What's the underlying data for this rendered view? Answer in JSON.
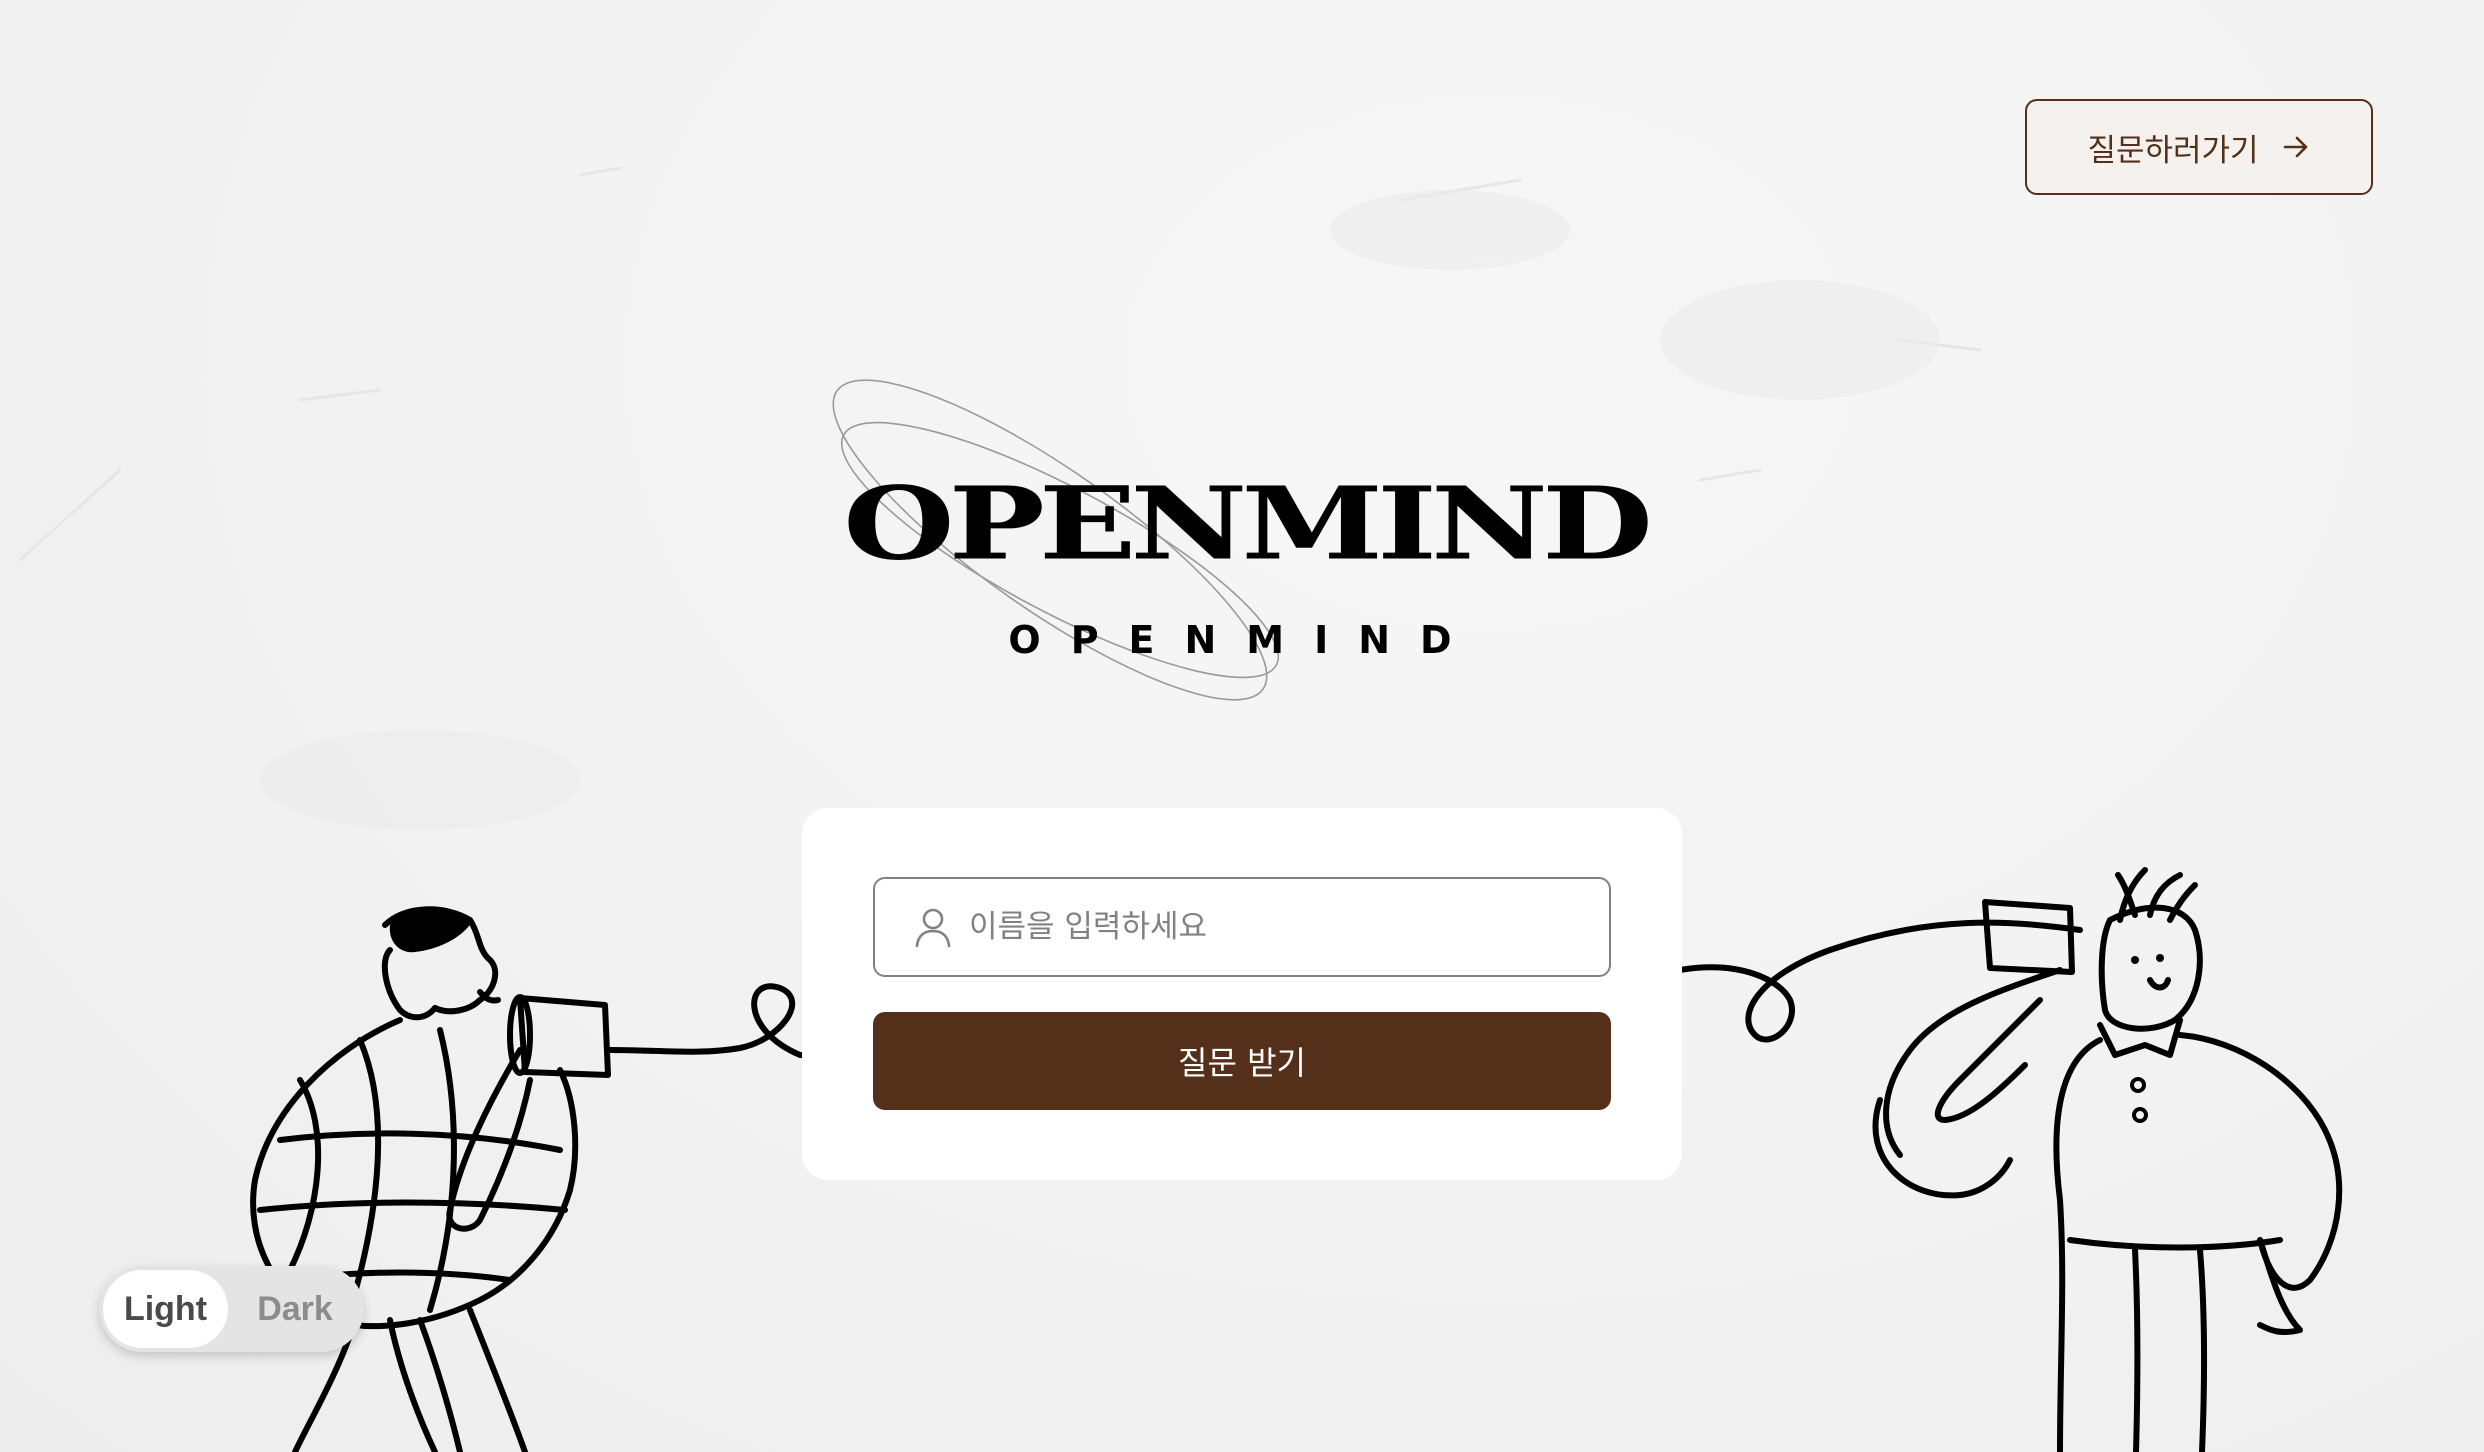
{
  "header": {
    "ask_button_label": "질문하러가기",
    "ask_button_icon": "arrow-right-icon"
  },
  "logo": {
    "title": "OPENMIND",
    "subtitle": "OPENMIND"
  },
  "form": {
    "name_placeholder": "이름을 입력하세요",
    "name_value": "",
    "input_icon": "person-icon",
    "submit_label": "질문 받기"
  },
  "theme_toggle": {
    "light_label": "Light",
    "dark_label": "Dark",
    "selected": "Light"
  },
  "colors": {
    "brand_brown": "#542f1a",
    "button_bg": "#f5f1ee",
    "input_border": "#818181"
  }
}
